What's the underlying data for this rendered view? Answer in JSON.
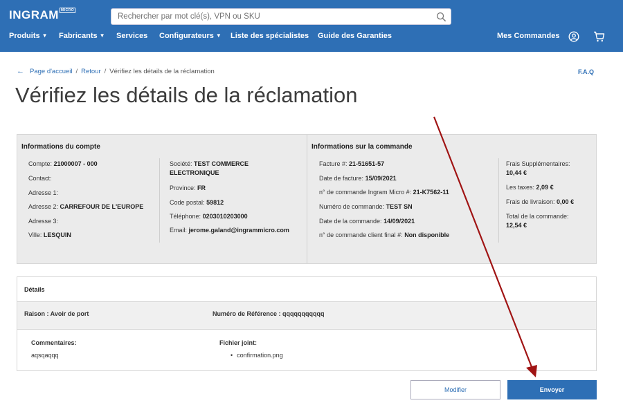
{
  "header": {
    "logo_text": "INGRAM",
    "logo_mark": "MICRO",
    "search_placeholder": "Rechercher par mot clé(s), VPN ou SKU",
    "nav": [
      {
        "label": "Produits"
      },
      {
        "label": "Fabricants"
      },
      {
        "label": "Services"
      },
      {
        "label": "Configurateurs"
      },
      {
        "label": "Liste des spécialistes"
      },
      {
        "label": "Guide des Garanties"
      }
    ],
    "orders_label": "Mes Commandes"
  },
  "breadcrumb": {
    "home": "Page d'accueil",
    "back": "Retour",
    "current": "Vérifiez les détails de la réclamation"
  },
  "faq_label": "F.A.Q",
  "page_title": "Vérifiez les détails de la réclamation",
  "account": {
    "title": "Informations du compte",
    "compte_label": "Compte:",
    "compte_value": "21000007 - 000",
    "contact_label": "Contact:",
    "adresse1_label": "Adresse 1:",
    "adresse2_label": "Adresse 2:",
    "adresse2_value": "CARREFOUR DE L'EUROPE",
    "adresse3_label": "Adresse 3:",
    "ville_label": "Ville:",
    "ville_value": "LESQUIN",
    "societe_label": "Société:",
    "societe_value_1": "TEST COMMERCE",
    "societe_value_2": "ELECTRONIQUE",
    "province_label": "Province:",
    "province_value": "FR",
    "cp_label": "Code postal:",
    "cp_value": "59812",
    "tel_label": "Téléphone:",
    "tel_value": "0203010203000",
    "email_label": "Email:",
    "email_value": "jerome.galand@ingrammicro.com"
  },
  "order": {
    "title": "Informations sur la commande",
    "facture_label": "Facture #:",
    "facture_value": "21-51651-57",
    "date_facture_label": "Date de facture:",
    "date_facture_value": "15/09/2021",
    "no_cmd_im_label": "n° de commande Ingram Micro #:",
    "no_cmd_im_value": "21-K7562-11",
    "num_cmd_label": "Numéro de commande:",
    "num_cmd_value": "TEST SN",
    "date_cmd_label": "Date de la commande:",
    "date_cmd_value": "14/09/2021",
    "no_client_label": "n° de commande client final #:",
    "no_client_value": "Non disponible",
    "frais_supp_label": "Frais Supplémentaires:",
    "frais_supp_value": "10,44 €",
    "taxes_label": "Les taxes:",
    "taxes_value": "2,09 €",
    "livraison_label": "Frais de livraison:",
    "livraison_value": "0,00 €",
    "total_label": "Total de la commande:",
    "total_value": "12,54 €"
  },
  "details": {
    "title": "Détails",
    "raison": "Raison : Avoir de port",
    "reference": "Numéro de Référence : qqqqqqqqqqq",
    "comments_label": "Commentaires:",
    "comments_value": "aqsqaqqq",
    "attachment_label": "Fichier joint:",
    "attachment_file": "confirmation.png"
  },
  "buttons": {
    "modify": "Modifier",
    "send": "Envoyer"
  },
  "colors": {
    "brand_blue": "#2e6fb5",
    "panel_gray": "#ebebeb",
    "arrow_red": "#a01414"
  }
}
